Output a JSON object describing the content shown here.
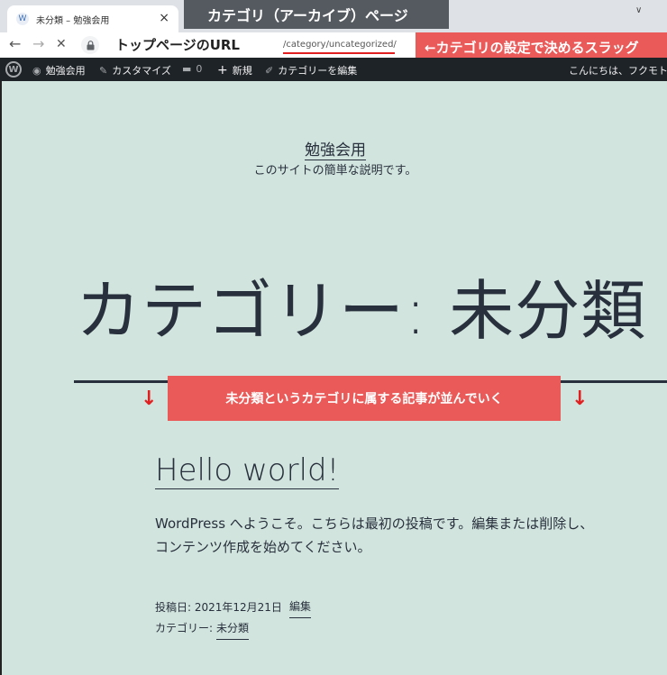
{
  "browser": {
    "tab_title": "未分類 – 勉強会用",
    "tab_close": "×",
    "new_tab": "+",
    "tab_dropdown": "∨",
    "nav_back": "←",
    "nav_forward": "→",
    "nav_stop": "✕",
    "url_path": "/category/uncategorized/"
  },
  "annotations": {
    "title": "カテゴリ（アーカイブ）ページ",
    "top_page_url": "トップページのURL",
    "slug": "←カテゴリの設定で決めるスラッグ",
    "posts_list": "未分類というカテゴリに属する記事が並んでいく",
    "arrow_down": "↓"
  },
  "admin_bar": {
    "site_name": "勉強会用",
    "customize": "カスタマイズ",
    "comments_count": "0",
    "new": "新規",
    "edit_category": "カテゴリーを編集",
    "greeting": "こんにちは、フクモト学"
  },
  "site": {
    "title": "勉強会用",
    "description": "このサイトの簡単な説明です。"
  },
  "archive": {
    "title": "カテゴリー: 未分類"
  },
  "post": {
    "title": "Hello world!",
    "excerpt": "WordPress へようこそ。こちらは最初の投稿です。編集または削除し、コンテンツ作成を始めてください。",
    "date_label": "投稿日: 2021年12月21日",
    "edit_link": "編集",
    "category_label": "カテゴリー:",
    "category_link": "未分類"
  },
  "colors": {
    "page_bg": "#d1e4dd",
    "admin_bar_bg": "#1e2327",
    "annotation_red": "#e95a58",
    "annotation_gray": "#555a60"
  }
}
